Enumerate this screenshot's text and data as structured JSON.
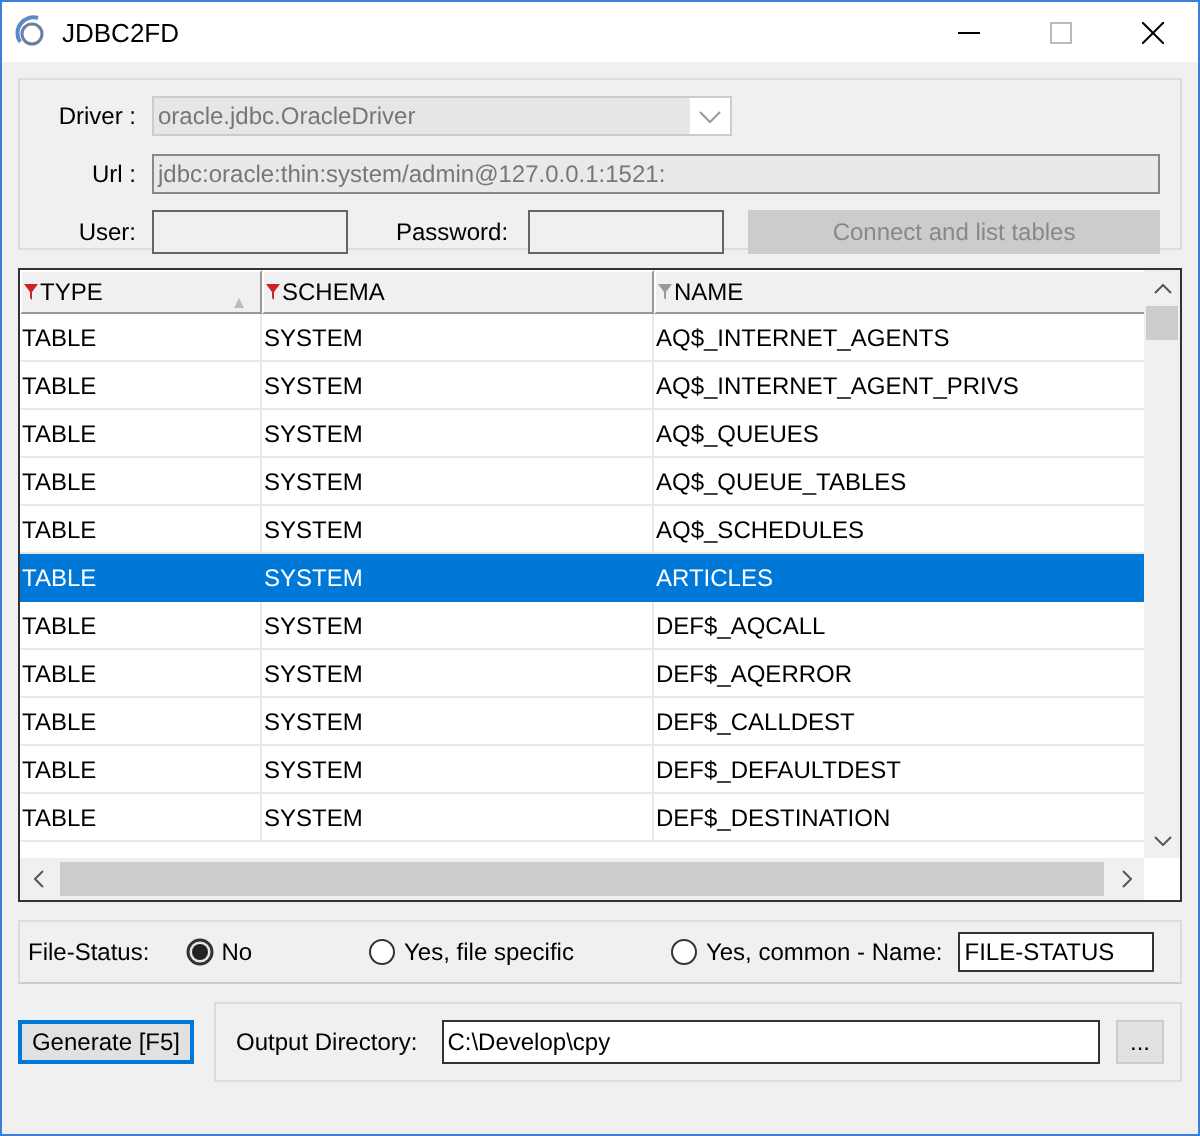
{
  "window": {
    "title": "JDBC2FD"
  },
  "connection": {
    "driver_label": "Driver :",
    "driver": "oracle.jdbc.OracleDriver",
    "url_label": "Url :",
    "url": "jdbc:oracle:thin:system/admin@127.0.0.1:1521:",
    "user_label": "User:",
    "password_label": "Password:",
    "connect_button": {
      "label": "Connect and list tables",
      "disabled": true
    }
  },
  "table": {
    "columns": [
      {
        "label": "TYPE",
        "filtered": true,
        "sorted": true
      },
      {
        "label": "SCHEMA",
        "filtered": true,
        "sorted": false
      },
      {
        "label": "NAME",
        "filtered": false,
        "sorted": false
      }
    ],
    "rows": [
      {
        "cells": [
          "TABLE",
          "SYSTEM",
          "AQ$_INTERNET_AGENTS"
        ],
        "selected": false
      },
      {
        "cells": [
          "TABLE",
          "SYSTEM",
          "AQ$_INTERNET_AGENT_PRIVS"
        ],
        "selected": false
      },
      {
        "cells": [
          "TABLE",
          "SYSTEM",
          "AQ$_QUEUES"
        ],
        "selected": false
      },
      {
        "cells": [
          "TABLE",
          "SYSTEM",
          "AQ$_QUEUE_TABLES"
        ],
        "selected": false
      },
      {
        "cells": [
          "TABLE",
          "SYSTEM",
          "AQ$_SCHEDULES"
        ],
        "selected": false
      },
      {
        "cells": [
          "TABLE",
          "SYSTEM",
          "ARTICLES"
        ],
        "selected": true
      },
      {
        "cells": [
          "TABLE",
          "SYSTEM",
          "DEF$_AQCALL"
        ],
        "selected": false
      },
      {
        "cells": [
          "TABLE",
          "SYSTEM",
          "DEF$_AQERROR"
        ],
        "selected": false
      },
      {
        "cells": [
          "TABLE",
          "SYSTEM",
          "DEF$_CALLDEST"
        ],
        "selected": false
      },
      {
        "cells": [
          "TABLE",
          "SYSTEM",
          "DEF$_DEFAULTDEST"
        ],
        "selected": false
      },
      {
        "cells": [
          "TABLE",
          "SYSTEM",
          "DEF$_DESTINATION"
        ],
        "selected": false
      }
    ]
  },
  "file_status": {
    "label": "File-Status:",
    "options": [
      {
        "label": "No",
        "selected": true
      },
      {
        "label": "Yes, file specific",
        "selected": false
      },
      {
        "label": "Yes, common - Name:",
        "selected": false
      }
    ],
    "name_value": "FILE-STATUS"
  },
  "generate_button": {
    "label": "Generate [F5]"
  },
  "output": {
    "label": "Output Directory:",
    "value": "C:\\Develop\\cpy",
    "browse_label": "..."
  }
}
